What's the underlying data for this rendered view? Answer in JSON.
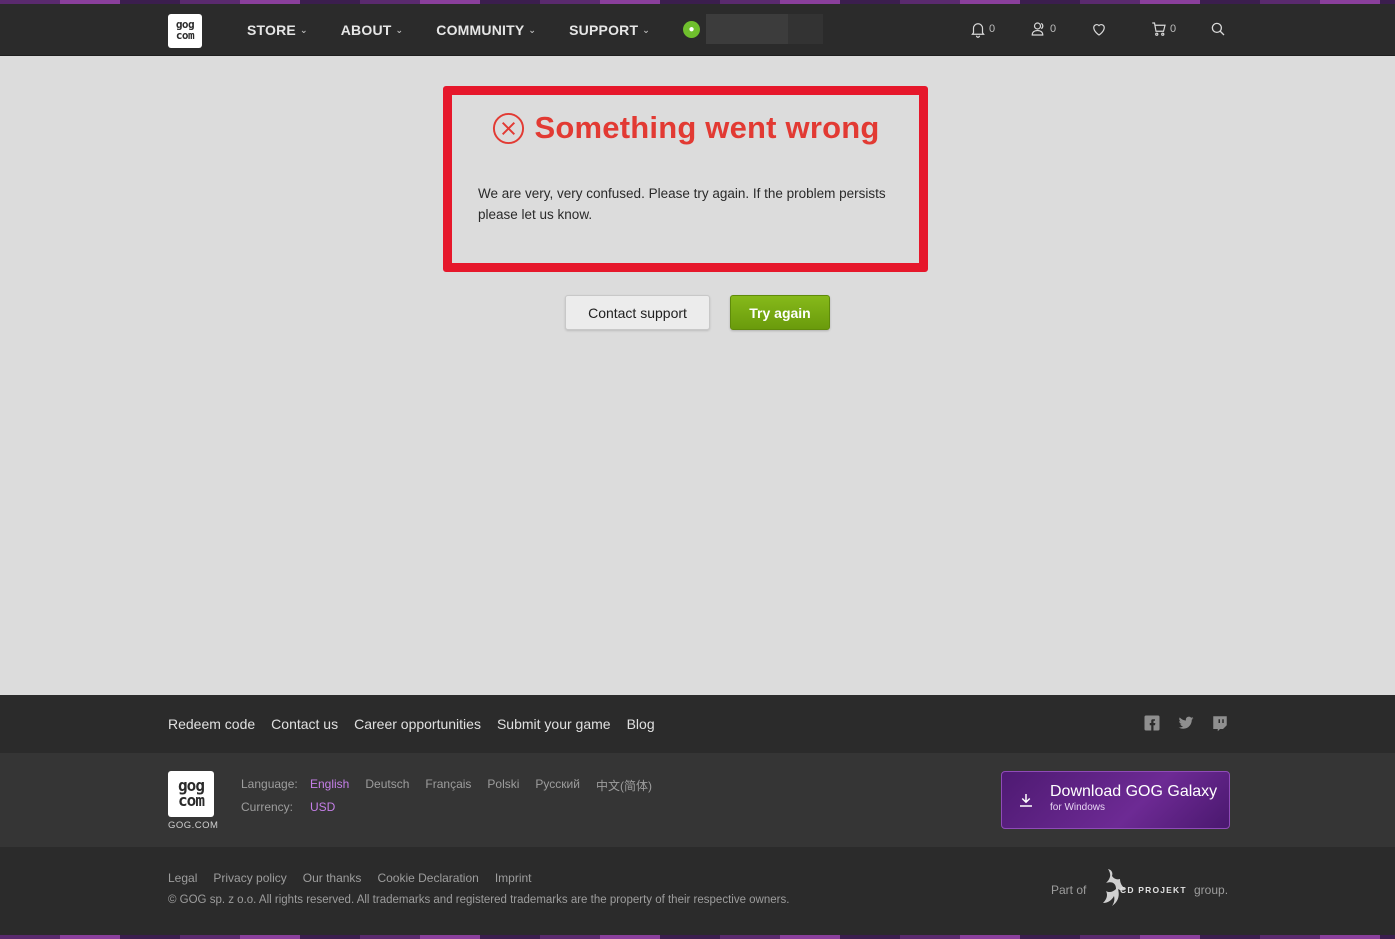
{
  "header": {
    "logo_text": "gog com",
    "nav": [
      {
        "label": "STORE"
      },
      {
        "label": "ABOUT"
      },
      {
        "label": "COMMUNITY"
      },
      {
        "label": "SUPPORT"
      }
    ],
    "notifications_count": "0",
    "friends_count": "0",
    "cart_count": "0"
  },
  "error": {
    "title": "Something went wrong",
    "message": "We are very, very confused. Please try again. If the problem persists please let us know.",
    "contact_label": "Contact support",
    "try_label": "Try again",
    "highlight_color": "#e6172b",
    "title_color": "#e23a33"
  },
  "footer": {
    "links": [
      "Redeem code",
      "Contact us",
      "Career opportunities",
      "Submit your game",
      "Blog"
    ],
    "logo_caption": "GOG.COM",
    "language_label": "Language:",
    "languages": [
      "English",
      "Deutsch",
      "Français",
      "Polski",
      "Русский",
      "中文(简体)"
    ],
    "currency_label": "Currency:",
    "currency": "USD",
    "galaxy_title": "Download GOG Galaxy",
    "galaxy_sub": "for Windows",
    "legal": [
      "Legal",
      "Privacy policy",
      "Our thanks",
      "Cookie Declaration",
      "Imprint"
    ],
    "copyright": "© GOG sp. z o.o. All rights reserved. All trademarks and registered trademarks are the property of their respective owners.",
    "part_of": "Part of",
    "cdp": "CD PROJEKT",
    "group": "group."
  },
  "colors": {
    "accent_green": "#86b91a",
    "purple_accent": "#c57fe8"
  }
}
